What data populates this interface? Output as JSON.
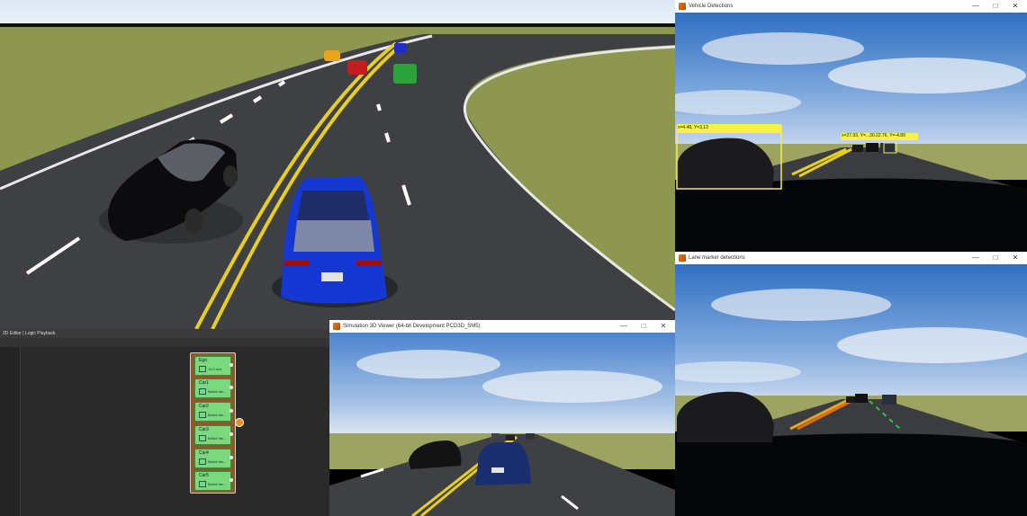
{
  "main_scene": {
    "description_icon": "3d-road-scene"
  },
  "vehicle_window": {
    "title": "Vehicle Detections",
    "ctrl_min": "—",
    "ctrl_max": "□",
    "ctrl_close": "✕",
    "bbox_left_label": "x=4.48, Y=3.13",
    "bbox_right_label": "x=27.93, Y=...30.22.76, Y=-4.89"
  },
  "lane_window": {
    "title": "Lane marker detections",
    "ctrl_min": "—",
    "ctrl_max": "□",
    "ctrl_close": "✕"
  },
  "viewer_window": {
    "title": "Simulation 3D Viewer (64-bit Development PCD3D_SM5)",
    "ctrl_min": "—",
    "ctrl_max": "□",
    "ctrl_close": "✕"
  },
  "editor": {
    "tab_label": "2D Editor | Logic Playback",
    "actors": [
      {
        "name": "Ego",
        "sub": "14.0 m/s"
      },
      {
        "name": "Car1",
        "sub": "Match lan..."
      },
      {
        "name": "Car2",
        "sub": "Match lan..."
      },
      {
        "name": "Car3",
        "sub": "Match lan..."
      },
      {
        "name": "Car4",
        "sub": "Match lan..."
      },
      {
        "name": "Car5",
        "sub": "Match lan..."
      }
    ]
  },
  "colors": {
    "accent": "#e8911f",
    "actor_green": "#7cd87c",
    "bbox_yellow": "#f6f048"
  }
}
